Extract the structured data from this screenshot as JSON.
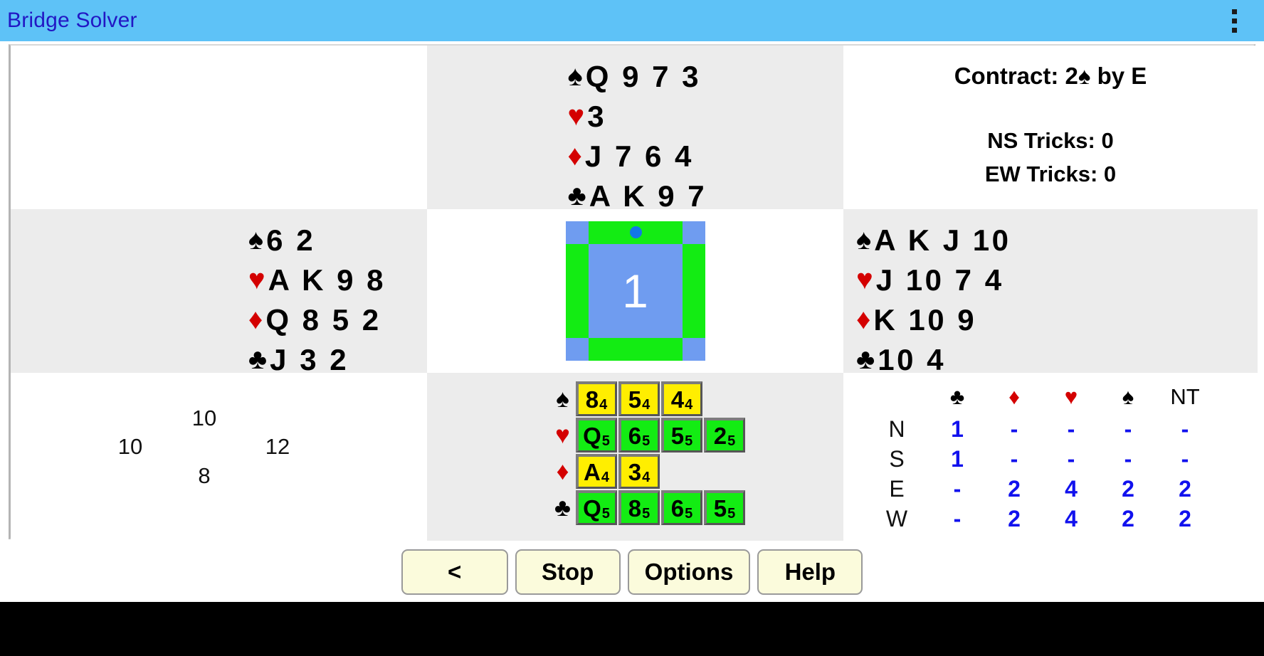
{
  "titlebar": {
    "app_title": "Bridge Solver",
    "overflow_icon": "more-vertical-icon"
  },
  "info": {
    "contract_label": "Contract: 2",
    "contract_suit": "♠",
    "contract_declarer": " by E",
    "ns_tricks": "NS Tricks: 0",
    "ew_tricks": "EW Tricks: 0"
  },
  "hands": {
    "north": {
      "spades_sym": "♠",
      "spades": "Q 9 7 3",
      "hearts_sym": "♥",
      "hearts": "3",
      "diamonds_sym": "♦",
      "diamonds": "J 7 6 4",
      "clubs_sym": "♣",
      "clubs": "A K 9 7"
    },
    "west": {
      "spades_sym": "♠",
      "spades": "6 2",
      "hearts_sym": "♥",
      "hearts": "A K 9 8",
      "diamonds_sym": "♦",
      "diamonds": "Q 8 5 2",
      "clubs_sym": "♣",
      "clubs": "J 3 2"
    },
    "east": {
      "spades_sym": "♠",
      "spades": "A K J 10",
      "hearts_sym": "♥",
      "hearts": "J 10 7 4",
      "diamonds_sym": "♦",
      "diamonds": "K 10 9",
      "clubs_sym": "♣",
      "clubs": "10 4"
    }
  },
  "play_widget": {
    "trick_number": "1",
    "lead_marker": "north",
    "frame_color": "#13ec13",
    "center_color": "#6f9cf0"
  },
  "hcp": {
    "north": "10",
    "west": "10",
    "east": "12",
    "south": "8"
  },
  "played_cards": {
    "rows": [
      {
        "suit": "♠",
        "suit_color": "black",
        "tile_color": "yellow",
        "cards": [
          {
            "rank": "8",
            "sub": "4"
          },
          {
            "rank": "5",
            "sub": "4"
          },
          {
            "rank": "4",
            "sub": "4"
          }
        ]
      },
      {
        "suit": "♥",
        "suit_color": "red",
        "tile_color": "green",
        "cards": [
          {
            "rank": "Q",
            "sub": "5"
          },
          {
            "rank": "6",
            "sub": "5"
          },
          {
            "rank": "5",
            "sub": "5"
          },
          {
            "rank": "2",
            "sub": "5"
          }
        ]
      },
      {
        "suit": "♦",
        "suit_color": "red",
        "tile_color": "yellow",
        "cards": [
          {
            "rank": "A",
            "sub": "4"
          },
          {
            "rank": "3",
            "sub": "4"
          }
        ]
      },
      {
        "suit": "♣",
        "suit_color": "black",
        "tile_color": "green",
        "cards": [
          {
            "rank": "Q",
            "sub": "5"
          },
          {
            "rank": "8",
            "sub": "5"
          },
          {
            "rank": "6",
            "sub": "5"
          },
          {
            "rank": "5",
            "sub": "5"
          }
        ]
      }
    ]
  },
  "double_dummy": {
    "columns": [
      {
        "label": "♣",
        "color": "black"
      },
      {
        "label": "♦",
        "color": "red"
      },
      {
        "label": "♥",
        "color": "red"
      },
      {
        "label": "♠",
        "color": "black"
      },
      {
        "label": "NT",
        "color": "black"
      }
    ],
    "rows": [
      {
        "dir": "N",
        "values": [
          "1",
          "-",
          "-",
          "-",
          "-"
        ]
      },
      {
        "dir": "S",
        "values": [
          "1",
          "-",
          "-",
          "-",
          "-"
        ]
      },
      {
        "dir": "E",
        "values": [
          "-",
          "2",
          "4",
          "2",
          "2"
        ]
      },
      {
        "dir": "W",
        "values": [
          "-",
          "2",
          "4",
          "2",
          "2"
        ]
      }
    ]
  },
  "buttons": {
    "prev": "<",
    "stop": "Stop",
    "options": "Options",
    "help": "Help"
  }
}
